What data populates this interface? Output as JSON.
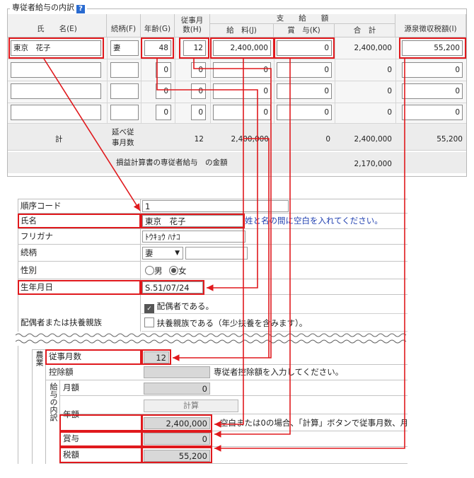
{
  "top_table": {
    "legend": "専従者給与の内訳",
    "help_icon": "?",
    "headers": {
      "name": "氏　　名(E)",
      "relation": "続柄(F)",
      "age": "年齢(G)",
      "months_l1": "従事月",
      "months_l2": "数(H)",
      "payment_group": "支　　給　　額",
      "salary": "給　料(J)",
      "bonus": "賞　与(K)",
      "total": "合　計",
      "withholding": "源泉徴収税額(I)"
    },
    "rows": [
      {
        "name": "東京　花子",
        "relation": "妻",
        "age": "48",
        "months": "12",
        "salary": "2,400,000",
        "bonus": "0",
        "total": "2,400,000",
        "tax": "55,200"
      },
      {
        "name": "",
        "relation": "",
        "age": "0",
        "months": "0",
        "salary": "0",
        "bonus": "0",
        "total": "0",
        "tax": "0"
      },
      {
        "name": "",
        "relation": "",
        "age": "0",
        "months": "0",
        "salary": "0",
        "bonus": "0",
        "total": "0",
        "tax": "0"
      },
      {
        "name": "",
        "relation": "",
        "age": "0",
        "months": "0",
        "salary": "0",
        "bonus": "0",
        "total": "0",
        "tax": "0"
      }
    ],
    "totals": {
      "label": "計",
      "months_label_l1": "延べ従",
      "months_label_l2": "事月数",
      "months": "12",
      "salary": "2,400,000",
      "bonus": "0",
      "total": "2,400,000",
      "tax": "55,200"
    },
    "pl_label": "損益計算書の専従者給与　の金額",
    "pl_amount": "2,170,000"
  },
  "form": {
    "order_code_label": "順序コード",
    "order_code": "1",
    "name_label": "氏名",
    "name": "東京　花子",
    "name_hint": "姓と名の間に空白を入れてください。",
    "kana_label": "フリガナ",
    "kana": "ﾄｳｷｮｳ ﾊﾅｺ",
    "relation_label": "続柄",
    "relation": "妻",
    "gender_label": "性別",
    "male": "男",
    "female": "女",
    "birth_label": "生年月日",
    "birth": "S.51/07/24",
    "dependent_label": "配偶者または扶養親族",
    "spouse_check": "配偶者である。",
    "dependent_check": "扶養親族である（年少扶養を含みます）。",
    "category_label": "農業",
    "months_label": "従事月数",
    "months": "12",
    "deduction_label": "控除額",
    "deduction_hint": "専従者控除額を入力してください。",
    "breakdown_label": "給与の内訳",
    "monthly_label": "月額",
    "monthly": "0",
    "calc_button": "計算",
    "annual_label": "年額",
    "annual": "2,400,000",
    "annual_hint": "空白または0の場合、「計算」ボタンで従事月数、月",
    "bonus_label": "賞与",
    "bonus": "0",
    "tax_label": "税額",
    "tax": "55,200"
  },
  "colors": {
    "highlight": "#e0191d",
    "link_text": "#1f3fb0"
  }
}
